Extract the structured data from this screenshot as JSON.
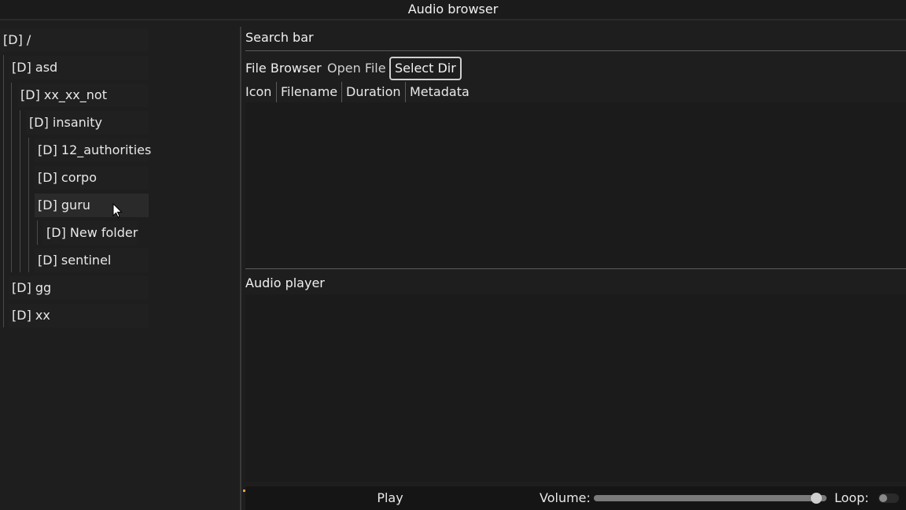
{
  "window": {
    "title": "Audio browser"
  },
  "tree": {
    "items": [
      {
        "label": "[D] /"
      },
      {
        "label": "[D] asd"
      },
      {
        "label": "[D] xx_xx_not"
      },
      {
        "label": "[D] insanity"
      },
      {
        "label": "[D] 12_authorities"
      },
      {
        "label": "[D] corpo"
      },
      {
        "label": "[D] guru"
      },
      {
        "label": "[D] New folder"
      },
      {
        "label": "[D] sentinel"
      },
      {
        "label": "[D] gg"
      },
      {
        "label": "[D] xx"
      }
    ]
  },
  "main": {
    "search_bar_label": "Search bar",
    "tabs": [
      {
        "label": "File Browser"
      },
      {
        "label": "Open File"
      },
      {
        "label": "Select Dir"
      }
    ],
    "columns": [
      "Icon",
      "Filename",
      "Duration",
      "Metadata"
    ],
    "audio_player_label": "Audio player"
  },
  "player": {
    "play_label": "Play",
    "volume_label": "Volume:",
    "volume_level": 0.98,
    "loop_label": "Loop:",
    "loop_enabled": false
  },
  "colors": {
    "background": "#1e1e1e",
    "accent": "#e8a040"
  }
}
